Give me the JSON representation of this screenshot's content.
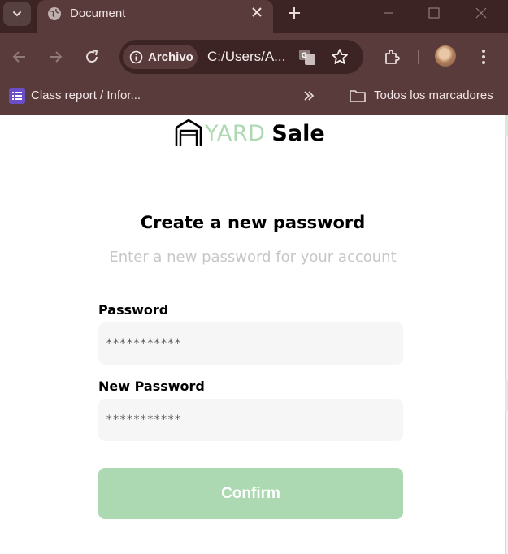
{
  "browser": {
    "tab_title": "Document",
    "site_chip_label": "Archivo",
    "url": "C:/Users/A...",
    "bookmark_label": "Class report / Infor...",
    "all_bookmarks_label": "Todos los marcadores"
  },
  "page": {
    "logo_yard": "YARD",
    "logo_sale": "Sale",
    "heading": "Create a new password",
    "subheading": "Enter a new password for your account",
    "password_label": "Password",
    "password_placeholder": "***********",
    "new_password_label": "New Password",
    "new_password_placeholder": "***********",
    "confirm_label": "Confirm"
  },
  "colors": {
    "accent_green": "#acd9b2",
    "browser_frame": "#5a3b3b",
    "titlebar": "#3d2424"
  }
}
